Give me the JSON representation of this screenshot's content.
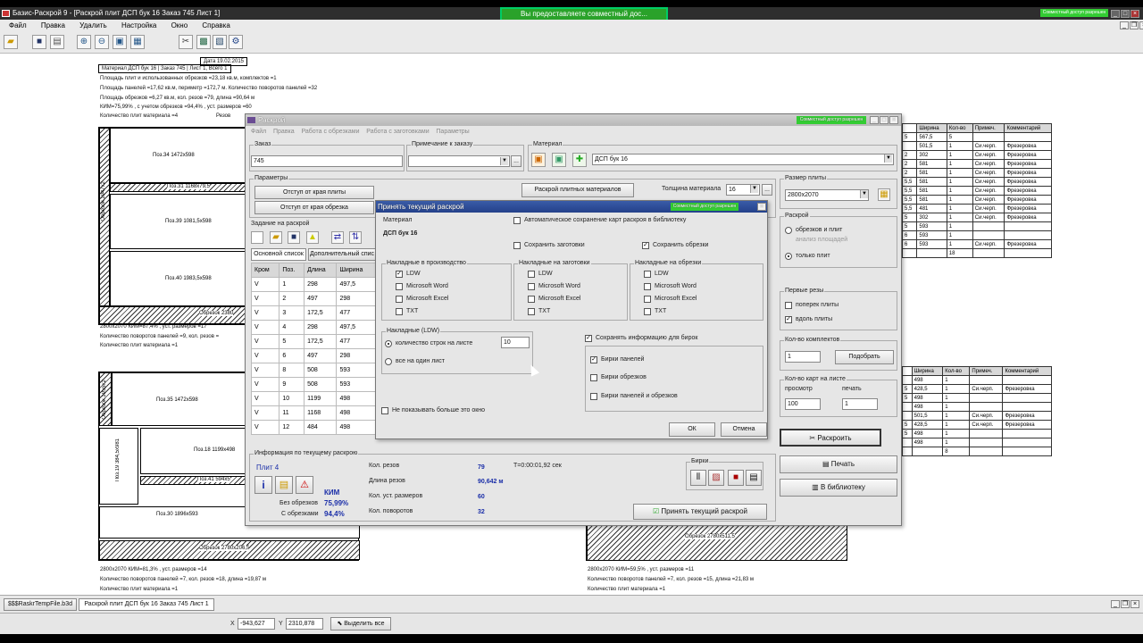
{
  "app": {
    "title": "Базис-Раскрой 9 - [Раскрой плит ДСП бук 16 Заказ 745 Лист 1]",
    "banner": "Вы предоставляете совместный дос...",
    "share_badge": "Совместный доступ разрешен"
  },
  "menu": [
    "Файл",
    "Правка",
    "Удалить",
    "Настройка",
    "Окно",
    "Справка"
  ],
  "sheet1": {
    "date_label": "Дата",
    "date": "19.02.2015",
    "material_label": "Материал ДСП бук 16",
    "order_label": "Заказ 745",
    "sheet_label": "Лист 1, Всего 1",
    "lines": [
      "Площадь плит и использованных обрезков =23,18 кв.м, комплектов =1",
      "Площадь панелей =17,62 кв.м, периметр =172,7 м. Количество поворотов панелей =32",
      "Площадь обрезков =6,27 кв.м, кол. резов =79, длина =90,64 м",
      "КИМ=75,99% , с учетом обрезков =94,4% , уст. размеров =60",
      "Количество плит материала =4"
    ],
    "resize_label": "Резов",
    "pieces": [
      "Поз.34 1472х598",
      "Поз.31 1168х79,5",
      "Поз.39 1081,5х598",
      "Поз.40 1983,5х598",
      "Обрезок 2380"
    ],
    "vert_label": "Обрезок 1947х2",
    "footer": [
      "2800х2070  КИМ=87,4% , уст. размеров =17",
      "Количество поворотов панелей =9, кол. резов =",
      "Количество плит материала =1"
    ]
  },
  "sheet2": {
    "pieces": [
      "Поз.35 1472х598",
      "Поз.18 1199х498",
      "Поз.41 594х5",
      "Поз.30 1896х593",
      "Обрезок 2780х206,5"
    ],
    "vert_a": "Обрезок 1955х2",
    "vert_b": "Поз.19 384,5х981",
    "footer": [
      "2800х2070  КИМ=81,3% , уст. размеров =14",
      "Количество поворотов панелей =7, кол. резов =18, длина =19,87 м",
      "Количество плит материала =1"
    ]
  },
  "sheet3": {
    "piece": "Обрезок 2780х511,5",
    "footer": [
      "2800х2070  КИМ=59,5% , уст. размеров =11",
      "Количество поворотов панелей =7, кол. резов =15, длина =21,83 м",
      "Количество плит материала =1"
    ]
  },
  "right_table1": {
    "headers": [
      "Ширина",
      "Кол-во",
      "Примеч.",
      "Комментарий"
    ],
    "rows": [
      [
        "5",
        "567,5",
        "5",
        "",
        ""
      ],
      [
        "",
        "501,5",
        "1",
        "Си.черп.",
        "Фрезеровка"
      ],
      [
        "2",
        "302",
        "1",
        "Си.черп.",
        "Фрезеровка"
      ],
      [
        "2",
        "581",
        "1",
        "Си.черп.",
        "Фрезеровка"
      ],
      [
        "2",
        "581",
        "1",
        "Си.черп.",
        "Фрезеровка"
      ],
      [
        "5,5",
        "581",
        "1",
        "Си.черп.",
        "Фрезеровка"
      ],
      [
        "5,5",
        "581",
        "1",
        "Си.черп.",
        "Фрезеровка"
      ],
      [
        "5,5",
        "581",
        "1",
        "Си.черп.",
        "Фрезеровка"
      ],
      [
        "5,5",
        "481",
        "1",
        "Си.черп.",
        "Фрезеровка"
      ],
      [
        "5",
        "302",
        "1",
        "Си.черп.",
        "Фрезеровка"
      ],
      [
        "5",
        "593",
        "1",
        "",
        ""
      ],
      [
        "6",
        "593",
        "1",
        "",
        ""
      ],
      [
        "6",
        "593",
        "1",
        "Си.черп.",
        "Фрезеровка"
      ],
      [
        "",
        "",
        "18",
        "",
        ""
      ]
    ]
  },
  "right_table2": {
    "headers": [
      "Ширина",
      "Кол-во",
      "Примеч.",
      "Комментарий"
    ],
    "rows": [
      [
        "",
        "498",
        "1",
        "",
        ""
      ],
      [
        "5",
        "428,5",
        "1",
        "Си.черп.",
        "Фрезеровка"
      ],
      [
        "5",
        "498",
        "1",
        "",
        ""
      ],
      [
        "",
        "498",
        "1",
        "",
        ""
      ],
      [
        "",
        "501,5",
        "1",
        "Си.черп.",
        "Фрезеровка"
      ],
      [
        "5",
        "428,5",
        "1",
        "Си.черп.",
        "Фрезеровка"
      ],
      [
        "5",
        "498",
        "1",
        "",
        ""
      ],
      [
        "",
        "498",
        "1",
        "",
        ""
      ],
      [
        "",
        "",
        "8",
        "",
        ""
      ]
    ]
  },
  "raskroy": {
    "title": "Раскрой",
    "share_badge": "Совместный доступ разрешен",
    "menu": [
      "Файл",
      "Правка",
      "Работа с обрезками",
      "Работа с заготовками",
      "Параметры"
    ],
    "order_label": "Заказ",
    "order_value": "745",
    "note_label": "Примечание к заказу",
    "note_value": "",
    "material_label": "Материал",
    "material_value": "ДСП бук 16",
    "params_label": "Параметры",
    "btn_plate_offset": "Отступ от края плиты",
    "btn_scrap_offset": "Отступ от края обрезка",
    "tab_plate": "Раскрой плитных материалов",
    "thickness_label": "Толщина материала",
    "thickness_value": "16",
    "task_label": "Задание на раскрой",
    "tab_main": "Основной список",
    "tab_extra": "Дополнительный спис",
    "table_headers": [
      "Кром",
      "Поз.",
      "Длина",
      "Ширина"
    ],
    "table_rows": [
      [
        "V",
        "1",
        "298",
        "497,5"
      ],
      [
        "V",
        "2",
        "497",
        "298"
      ],
      [
        "V",
        "3",
        "172,5",
        "477"
      ],
      [
        "V",
        "4",
        "298",
        "497,5"
      ],
      [
        "V",
        "5",
        "172,5",
        "477"
      ],
      [
        "V",
        "6",
        "497",
        "298"
      ],
      [
        "V",
        "8",
        "508",
        "593"
      ],
      [
        "V",
        "9",
        "508",
        "593"
      ],
      [
        "V",
        "10",
        "1199",
        "498"
      ],
      [
        "V",
        "11",
        "1168",
        "498"
      ],
      [
        "V",
        "12",
        "484",
        "498"
      ]
    ],
    "info_label": "Информация по текущему раскрою",
    "plate_label": "Плит",
    "plate_count": "4",
    "kim_label": "КИМ",
    "no_scrap_label": "Без обрезков",
    "no_scrap_value": "75,99%",
    "with_scrap_label": "С обрезками",
    "with_scrap_value": "94,4%",
    "stats": [
      {
        "label": "Кол. резов",
        "value": "79"
      },
      {
        "label": "Длина резов",
        "value": "90,642 м"
      },
      {
        "label": "Кол. уст. размеров",
        "value": "60"
      },
      {
        "label": "Кол. поворотов",
        "value": "32"
      }
    ],
    "time_text": "T=0:00:01,92 сек",
    "labels_group": "Бирки",
    "accept_button": "Принять текущий раскрой",
    "size_label": "Размер плиты",
    "size_value": "2800х2070",
    "raskroy_group": "Раскрой",
    "radio_scraps": "обрезков и плит",
    "radio_area": "анализ площадей",
    "radio_plates": "только плит",
    "first_cuts": "Первые резы",
    "across": "поперек плиты",
    "along": "вдоль плиты",
    "kits_label": "Кол-во комплектов",
    "kits_value": "1",
    "pick_button": "Подобрать",
    "maps_label": "Кол-во карт на листе",
    "view_label": "просмотр",
    "print_label": "печать",
    "view_value": "100",
    "print_value": "1",
    "raskroit_button": "Раскроить",
    "print_button": "Печать",
    "library_button": "В библиотеку"
  },
  "dialog": {
    "title": "Принять текущий раскрой",
    "share_badge": "Совместный доступ разрешен",
    "material_label": "Материал",
    "material_value": "ДСП бук 16",
    "autosave": "Автоматическое сохранение карт раскроя в библиотеку",
    "save_blanks": "Сохранить заготовки",
    "save_scraps": "Сохранить обрезки",
    "grp_production": "Накладные в производство",
    "grp_blanks": "Накладные на заготовки",
    "grp_scraps": "Накладные на обрезки",
    "opt_ldw": "LDW",
    "opt_word": "Microsoft Word",
    "opt_excel": "Microsoft Excel",
    "opt_txt": "TXT",
    "grp_ldw": "Накладные (LDW)",
    "rows_per_sheet": "количество строк на листе",
    "rows_value": "10",
    "all_on_sheet": "все на один лист",
    "save_info": "Сохранять информацию для бирок",
    "tags_panels": "Бирки панелей",
    "tags_scraps": "Бирки обрезков",
    "tags_both": "Бирки панелей и обрезков",
    "dont_show": "Не показывать больше это окно",
    "ok": "ОК",
    "cancel": "Отмена"
  },
  "taskbar": {
    "item1": "$$$RaskrTempFile.b3d",
    "item2": "Раскрой плит ДСП бук 16 Заказ 745 Лист 1"
  },
  "status": {
    "x_label": "X",
    "x_value": "-943,627",
    "y_label": "Y",
    "y_value": "2310,878",
    "select_all": "Выделить все"
  }
}
